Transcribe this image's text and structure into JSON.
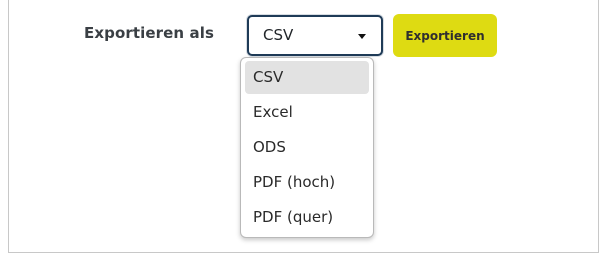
{
  "export_form": {
    "label": "Exportieren als",
    "select": {
      "value": "CSV",
      "caret_icon": "caret-down-icon"
    },
    "export_button_label": "Exportieren",
    "options": [
      "CSV",
      "Excel",
      "ODS",
      "PDF (hoch)",
      "PDF (quer)"
    ],
    "selected_option": "CSV"
  },
  "colors": {
    "button_background": "#dedb12",
    "select_border": "#1f3b57",
    "selected_option_background": "#e2e2e2"
  }
}
